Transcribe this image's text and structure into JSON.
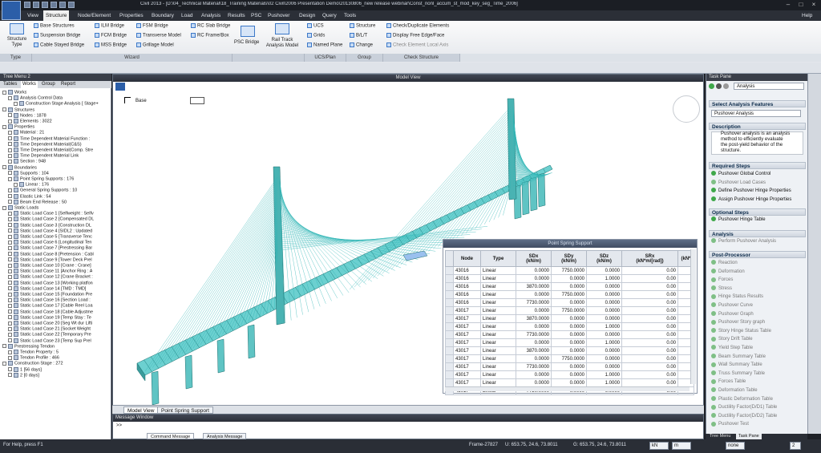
{
  "title_bar": {
    "title": "Civil 2013 - [D:\\04_Technical Material\\18_Training Materials\\02 Civil\\2006 Presentation Demo\\20130806_new release webinar\\Const_nonl_accum_st_mod_key_seg_Time_2006]"
  },
  "menu": {
    "items": [
      "View",
      "Structure",
      "Node/Element",
      "Properties",
      "Boundary",
      "Load",
      "Analysis",
      "Results",
      "PSC",
      "Pushover",
      "Design",
      "Query",
      "Tools"
    ],
    "active": "Structure",
    "help": "Help"
  },
  "ribbon": {
    "type_group": {
      "big_button": "Structure Type",
      "label": "Type"
    },
    "wizard_col1": [
      "Base Structures",
      "Suspension Bridge",
      "Cable Stayed Bridge"
    ],
    "wizard_col2": [
      "ILM Bridge",
      "FCM Bridge",
      "MSS Bridge"
    ],
    "wizard_col3": [
      "FSM Bridge",
      "Transverse Model",
      "Grillage Model"
    ],
    "wizard_col4": [
      "RC Slab Bridge",
      "RC Frame/Box"
    ],
    "wizard_label": "Wizard",
    "psc_bridge": "PSC Bridge",
    "rail_track": "Rail Track Analysis Model",
    "ucs_items": [
      "UCS",
      "Grids",
      "Named Plane"
    ],
    "ucs_label": "UCS/Plan",
    "group_items": [
      "Structure",
      "B/L/T",
      "Change"
    ],
    "group_label": "Group",
    "check_items": [
      "Check/Duplicate Elements",
      "Display Free Edge/Face",
      "Check Element Local Axis"
    ],
    "check_label": "Check Structure"
  },
  "tree": {
    "header": "Tree Menu 2",
    "tabs": [
      "Tables",
      "Works",
      "Group",
      "Report"
    ],
    "active_tab": "Works",
    "items": [
      "Works",
      "Analysis Control Data",
      "Construction Stage Analysis [ Stage+",
      "Structures",
      "Nodes : 1878",
      "Elements : 3022",
      "Properties",
      "Material : 21",
      "Time Dependent Material Function :",
      "Time Dependent Material(C&S)",
      "Time Dependent Material(Comp. Stre",
      "Time Dependent Material Link",
      "Section : 948",
      "Boundaries",
      "Supports : 104",
      "Point Spring Supports : 176",
      "Linear : 176",
      "General Spring Supports : 10",
      "Elastic Link : 54",
      "Beam End Release : 50",
      "Static Loads",
      "Static Load Case 1 [Selfweight : Selfv",
      "Static Load Case 2 [Compensated DL",
      "Static Load Case 3 [Construction DL",
      "Static Load Case 4 [SIDL2 : Updated",
      "Static Load Case 5 [Transverse Tenc",
      "Static Load Case 6 [Longitudinal Ten",
      "Static Load Case 7 [Prestressing Bar",
      "Static Load Case 8 [Pretension : Cabl",
      "Static Load Case 9 [Tower Deck Prel",
      "Static Load Case 10 [Crane : Crane]",
      "Static Load Case 11 [Anchor Ring : A",
      "Static Load Case 12 [Crane Bracket :",
      "Static Load Case 13 [Working platfon",
      "Static Load Case 14 [TMD : TMD]",
      "Static Load Case 15 [Foundation Pre",
      "Static Load Case 16 [Section Load :",
      "Static Load Case 17 [Cable Reel Loa",
      "Static Load Case 18 [Cable Adjustme",
      "Static Load Case 19 [Temp Stay : Te",
      "Static Load Case 20 [Seg Wt dur Lifti",
      "Static Load Case 21 [Socket Weight",
      "Static Load Case 22 [Temporary Pre",
      "Static Load Case 23 [Temp Sup Prel",
      "Prestressing Tendon",
      "Tendon Property : 5",
      "Tendon Profile : 466",
      "Construction Stage : 272",
      "1 [56 days]",
      "2 [0 days]"
    ]
  },
  "model_view": {
    "title": "Model View",
    "base_label": "Base"
  },
  "bottom_tabs": [
    "Model View",
    "Point Spring Support"
  ],
  "spring_table": {
    "title": "Point Spring Support",
    "columns": [
      "Node",
      "Type",
      "SDx\n(kN/m)",
      "SDy\n(kN/m)",
      "SDz\n(kN/m)",
      "SRx\n(kN*m/[rad])",
      "(kN*"
    ],
    "rows": [
      [
        "43016",
        "Linear",
        "0.0000",
        "7750.0000",
        "0.0000",
        "0.00"
      ],
      [
        "43016",
        "Linear",
        "0.0000",
        "0.0000",
        "1.0000",
        "0.00"
      ],
      [
        "43016",
        "Linear",
        "3870.0000",
        "0.0000",
        "0.0000",
        "0.00"
      ],
      [
        "43016",
        "Linear",
        "0.0000",
        "7750.0000",
        "0.0000",
        "0.00"
      ],
      [
        "43016",
        "Linear",
        "7730.0000",
        "0.0000",
        "0.0000",
        "0.00"
      ],
      [
        "43017",
        "Linear",
        "0.0000",
        "7750.0000",
        "0.0000",
        "0.00"
      ],
      [
        "43017",
        "Linear",
        "3870.0000",
        "0.0000",
        "0.0000",
        "0.00"
      ],
      [
        "43017",
        "Linear",
        "0.0000",
        "0.0000",
        "1.0000",
        "0.00"
      ],
      [
        "43017",
        "Linear",
        "7730.0000",
        "0.0000",
        "0.0000",
        "0.00"
      ],
      [
        "43017",
        "Linear",
        "0.0000",
        "0.0000",
        "1.0000",
        "0.00"
      ],
      [
        "43017",
        "Linear",
        "3870.0000",
        "0.0000",
        "0.0000",
        "0.00"
      ],
      [
        "43017",
        "Linear",
        "0.0000",
        "7750.0000",
        "0.0000",
        "0.00"
      ],
      [
        "43017",
        "Linear",
        "7730.0000",
        "0.0000",
        "0.0000",
        "0.00"
      ],
      [
        "43017",
        "Linear",
        "0.0000",
        "0.0000",
        "1.0000",
        "0.00"
      ],
      [
        "43017",
        "Linear",
        "0.0000",
        "0.0000",
        "1.0000",
        "0.00"
      ],
      [
        "43017",
        "Linear",
        "7730.0000",
        "0.0000",
        "0.0000",
        "0.00"
      ]
    ]
  },
  "task_pane": {
    "header": "Task Pane",
    "combo": "Analysis",
    "sel_title": "Select Analysis Features",
    "sel_value": "Pushover Analysis",
    "desc_title": "Description",
    "desc_text": [
      "Pushover analysis is an analysis",
      "method to efficiently evaluate",
      "the post-yield behavior of the",
      "structure."
    ],
    "req_title": "Required Steps",
    "req": [
      "Pushover Global Control",
      "Pushover Load Cases",
      "Define Pushover Hinge Properties",
      "Assign Pushover Hinge Properties"
    ],
    "opt_title": "Optional Steps",
    "opt": [
      "Pushover Hinge Table"
    ],
    "ana_title": "Analysis",
    "ana": [
      "Perform Pushover Analysis"
    ],
    "post_title": "Post-Processor",
    "post": [
      "Reaction",
      "Deformation",
      "Forces",
      "Stress",
      "Hinge Status Results",
      "Pushover Curve",
      "Pushover Graph",
      "Pushover Story graph",
      "Story Hinge Status Table",
      "Story Drift Table",
      "Yield Step Table",
      "Beam Summary Table",
      "Wall Summary Table",
      "Truss Summary Table",
      "Forces Table",
      "Deformation Table",
      "Plastic Deformation Table",
      "Ductility Factor(D/D1) Table",
      "Ductility Factor(D/D2) Table",
      "Pushover Test"
    ]
  },
  "message": {
    "title": "Message Window",
    "prompt": ">>",
    "tabs": [
      "Command Message",
      "Analysis Message"
    ]
  },
  "tree_bottom_tabs": [
    "Tree Menu",
    "Task Pane"
  ],
  "status": {
    "help": "For Help, press F1",
    "frame": "Frame-27827",
    "u": "U: 653.75, 24.6, 73.8011",
    "g": "G: 653.75, 24.6, 73.8011",
    "unit1": "kN",
    "unit2": "m",
    "none": "none",
    "page": "2"
  },
  "colors": {
    "bridge": "#2fb5b5",
    "accent": "#3c78c8"
  }
}
